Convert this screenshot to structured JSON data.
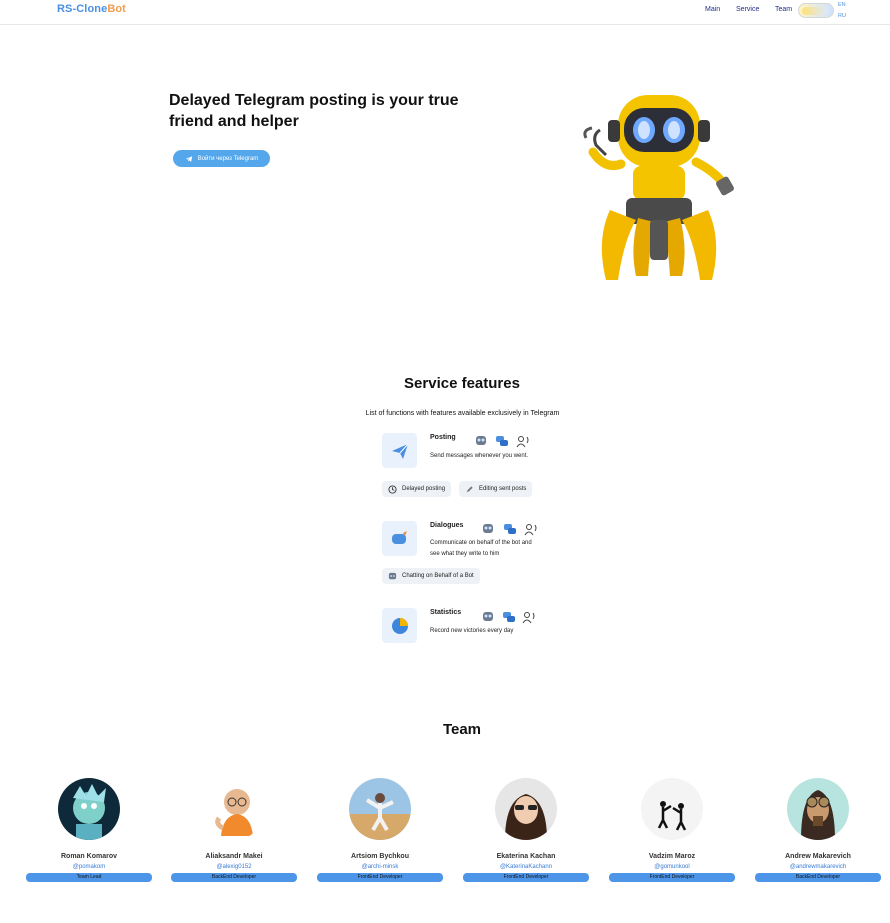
{
  "header": {
    "logo_a": "RS-Clone",
    "logo_b": "Bot",
    "nav": [
      "Main",
      "Service",
      "Team"
    ],
    "lang_en": "EN",
    "lang_ru": "RU"
  },
  "hero": {
    "title": "Delayed Telegram posting is your true friend and helper",
    "button_label": "Войти через Telegram"
  },
  "features": {
    "title": "Service features",
    "subtitle": "List of functions with features available exclusively in Telegram",
    "items": [
      {
        "name": "Posting",
        "desc": "Send messages whenever you went.",
        "chips": [
          "Delayed posting",
          "Editing sent posts"
        ]
      },
      {
        "name": "Dialogues",
        "desc": "Communicate on behalf of the bot and see what they write to him",
        "chips": [
          "Chatting on Behalf of a Bot"
        ]
      },
      {
        "name": "Statistics",
        "desc": "Record new victories every day",
        "chips": []
      }
    ]
  },
  "team": {
    "title": "Team",
    "members": [
      {
        "name": "Roman Komarov",
        "handle": "@pomakom",
        "role": "Team Lead"
      },
      {
        "name": "Aliaksandr Makei",
        "handle": "@alexig0152",
        "role": "BackEnd Developer"
      },
      {
        "name": "Artsiom Bychkou",
        "handle": "@archi-minsk",
        "role": "FrontEnd Developer"
      },
      {
        "name": "Ekaterina Kachan",
        "handle": "@KaterinaKachann",
        "role": "FrontEnd Developer"
      },
      {
        "name": "Vadzim Maroz",
        "handle": "@gomunkool",
        "role": "FrontEnd Developer"
      },
      {
        "name": "Andrew Makarevich",
        "handle": "@andrewmakarevich",
        "role": "BackEnd Developer"
      }
    ]
  },
  "colors": {
    "accent": "#4a90e2",
    "brand_orange": "#f39c4a",
    "button": "#55a7ec",
    "role_badge": "#4d95e8"
  },
  "icons": [
    "telegram-icon",
    "send-icon",
    "chat-icon",
    "pie-chart-icon",
    "robot-icon",
    "bubbles-icon",
    "voice-icon",
    "clock-icon",
    "edit-icon"
  ]
}
